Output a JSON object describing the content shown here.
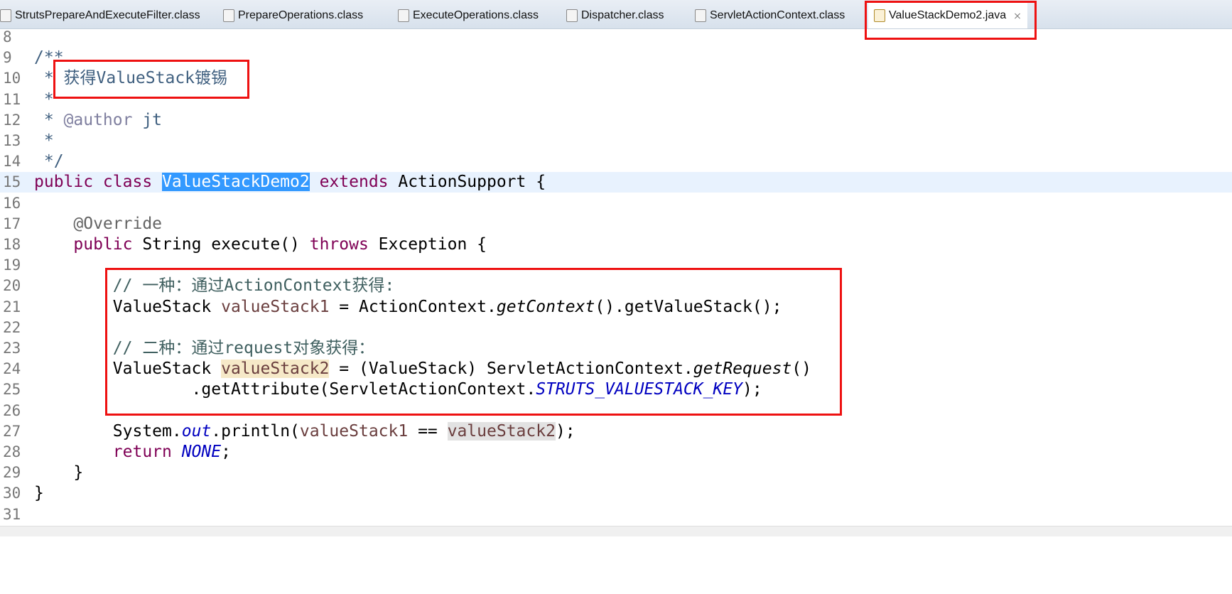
{
  "tabs": [
    {
      "label": "StrutsPrepareAndExecuteFilter.class",
      "icon": "class-file-icon",
      "active": false
    },
    {
      "label": "PrepareOperations.class",
      "icon": "class-file-icon",
      "active": false
    },
    {
      "label": "ExecuteOperations.class",
      "icon": "class-file-icon",
      "active": false
    },
    {
      "label": "Dispatcher.class",
      "icon": "class-file-icon",
      "active": false
    },
    {
      "label": "ServletActionContext.class",
      "icon": "class-file-icon",
      "active": false
    },
    {
      "label": "ValueStackDemo2.java",
      "icon": "java-file-icon",
      "active": true,
      "close": "⨯"
    }
  ],
  "highlight_color": "#ee1111",
  "current_line": 15,
  "lines": [
    {
      "num": "8",
      "tokens": []
    },
    {
      "num": "9",
      "tokens": [
        {
          "t": "/**",
          "c": "jd"
        }
      ]
    },
    {
      "num": "10",
      "tokens": [
        {
          "t": " * ",
          "c": "jd"
        },
        {
          "t": "获得ValueStack镀锡",
          "c": "jd"
        }
      ]
    },
    {
      "num": "11",
      "tokens": [
        {
          "t": " *",
          "c": "jd"
        }
      ]
    },
    {
      "num": "12",
      "tokens": [
        {
          "t": " * ",
          "c": "jd"
        },
        {
          "t": "@author",
          "c": "tag"
        },
        {
          "t": " jt",
          "c": "jd"
        }
      ]
    },
    {
      "num": "13",
      "tokens": [
        {
          "t": " *",
          "c": "jd"
        }
      ]
    },
    {
      "num": "14",
      "tokens": [
        {
          "t": " */",
          "c": "jd"
        }
      ]
    },
    {
      "num": "15",
      "tokens": [
        {
          "t": "public class ",
          "c": "kw"
        },
        {
          "t": "ValueStackDemo2",
          "c": "sel"
        },
        {
          "t": " extends ",
          "c": "kw"
        },
        {
          "t": "ActionSupport {",
          "c": ""
        }
      ]
    },
    {
      "num": "16",
      "tokens": []
    },
    {
      "num": "17",
      "tokens": [
        {
          "t": "    ",
          "c": ""
        },
        {
          "t": "@Override",
          "c": "ann"
        }
      ]
    },
    {
      "num": "18",
      "tokens": [
        {
          "t": "    ",
          "c": ""
        },
        {
          "t": "public",
          "c": "kw"
        },
        {
          "t": " String execute() ",
          "c": ""
        },
        {
          "t": "throws",
          "c": "kw"
        },
        {
          "t": " Exception {",
          "c": ""
        }
      ]
    },
    {
      "num": "19",
      "tokens": []
    },
    {
      "num": "20",
      "tokens": [
        {
          "t": "        ",
          "c": ""
        },
        {
          "t": "// 一种：通过ActionContext获得:",
          "c": "cm"
        }
      ]
    },
    {
      "num": "21",
      "tokens": [
        {
          "t": "        ValueStack ",
          "c": ""
        },
        {
          "t": "valueStack1",
          "c": "var"
        },
        {
          "t": " = ActionContext.",
          "c": ""
        },
        {
          "t": "getContext",
          "c": "it"
        },
        {
          "t": "().getValueStack();",
          "c": ""
        }
      ]
    },
    {
      "num": "22",
      "tokens": []
    },
    {
      "num": "23",
      "tokens": [
        {
          "t": "        ",
          "c": ""
        },
        {
          "t": "// 二种：通过request对象获得：",
          "c": "cm"
        }
      ]
    },
    {
      "num": "24",
      "tokens": [
        {
          "t": "        ValueStack ",
          "c": ""
        },
        {
          "t": "valueStack2",
          "c": "var occ"
        },
        {
          "t": " = (ValueStack) ServletActionContext.",
          "c": ""
        },
        {
          "t": "getRequest",
          "c": "it"
        },
        {
          "t": "()",
          "c": ""
        }
      ]
    },
    {
      "num": "25",
      "tokens": [
        {
          "t": "                .getAttribute(ServletActionContext.",
          "c": ""
        },
        {
          "t": "STRUTS_VALUESTACK_KEY",
          "c": "sf"
        },
        {
          "t": ");",
          "c": ""
        }
      ]
    },
    {
      "num": "26",
      "tokens": []
    },
    {
      "num": "27",
      "tokens": [
        {
          "t": "        System.",
          "c": ""
        },
        {
          "t": "out",
          "c": "sf"
        },
        {
          "t": ".println(",
          "c": ""
        },
        {
          "t": "valueStack1",
          "c": "var"
        },
        {
          "t": " == ",
          "c": ""
        },
        {
          "t": "valueStack2",
          "c": "var occ2"
        },
        {
          "t": ");",
          "c": ""
        }
      ]
    },
    {
      "num": "28",
      "tokens": [
        {
          "t": "        ",
          "c": ""
        },
        {
          "t": "return",
          "c": "kw"
        },
        {
          "t": " ",
          "c": ""
        },
        {
          "t": "NONE",
          "c": "sf"
        },
        {
          "t": ";",
          "c": ""
        }
      ]
    },
    {
      "num": "29",
      "tokens": [
        {
          "t": "    }",
          "c": ""
        }
      ]
    },
    {
      "num": "30",
      "tokens": [
        {
          "t": "}",
          "c": ""
        }
      ]
    },
    {
      "num": "31",
      "tokens": []
    }
  ]
}
